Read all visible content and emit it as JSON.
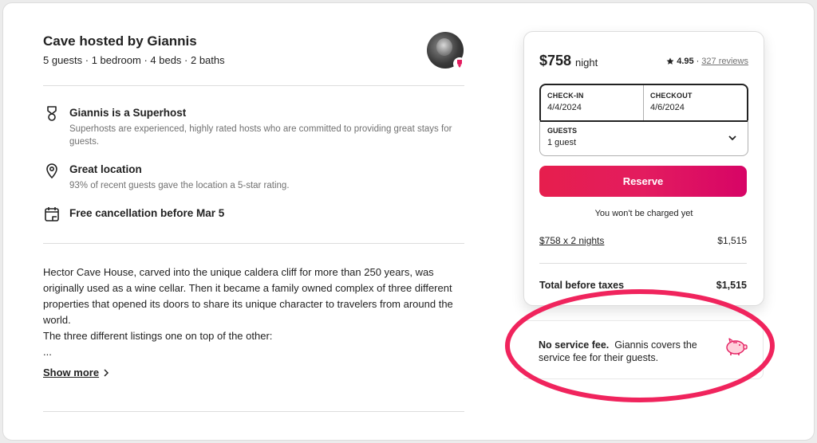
{
  "listing": {
    "title": "Cave hosted by Giannis",
    "subtitle": "5 guests · 1 bedroom · 4 beds · 2 baths"
  },
  "features": [
    {
      "icon": "superhost-medal-icon",
      "title": "Giannis is a Superhost",
      "description": "Superhosts are experienced, highly rated hosts who are committed to providing great stays for guests."
    },
    {
      "icon": "location-pin-icon",
      "title": "Great location",
      "description": "93% of recent guests gave the location a 5-star rating."
    },
    {
      "icon": "calendar-icon",
      "title": "Free cancellation before Mar 5",
      "description": ""
    }
  ],
  "description": {
    "text": "Hector Cave House, carved into the unique caldera cliff for more than 250 years, was originally used as a wine cellar. Then it became a family owned complex of three different properties that opened its doors to share its unique character to travelers from around the world.\nThe three different listings one on top of the other:\n...",
    "show_more": "Show more"
  },
  "booking": {
    "price": "$758",
    "per_night": "night",
    "rating_score": "4.95",
    "rating_sep": "·",
    "reviews": "327 reviews",
    "checkin_label": "CHECK-IN",
    "checkin_value": "4/4/2024",
    "checkout_label": "CHECKOUT",
    "checkout_value": "4/6/2024",
    "guests_label": "GUESTS",
    "guests_value": "1 guest",
    "reserve_label": "Reserve",
    "note": "You won't be charged yet",
    "line_label": "$758 x 2 nights",
    "line_value": "$1,515",
    "total_label": "Total before taxes",
    "total_value": "$1,515"
  },
  "service_fee": {
    "bold": "No service fee.",
    "text": "Giannis covers the service fee for their guests."
  },
  "colors": {
    "accent": "#e31c5f",
    "annotation": "#f0245d",
    "text": "#222222",
    "muted": "#717171"
  }
}
